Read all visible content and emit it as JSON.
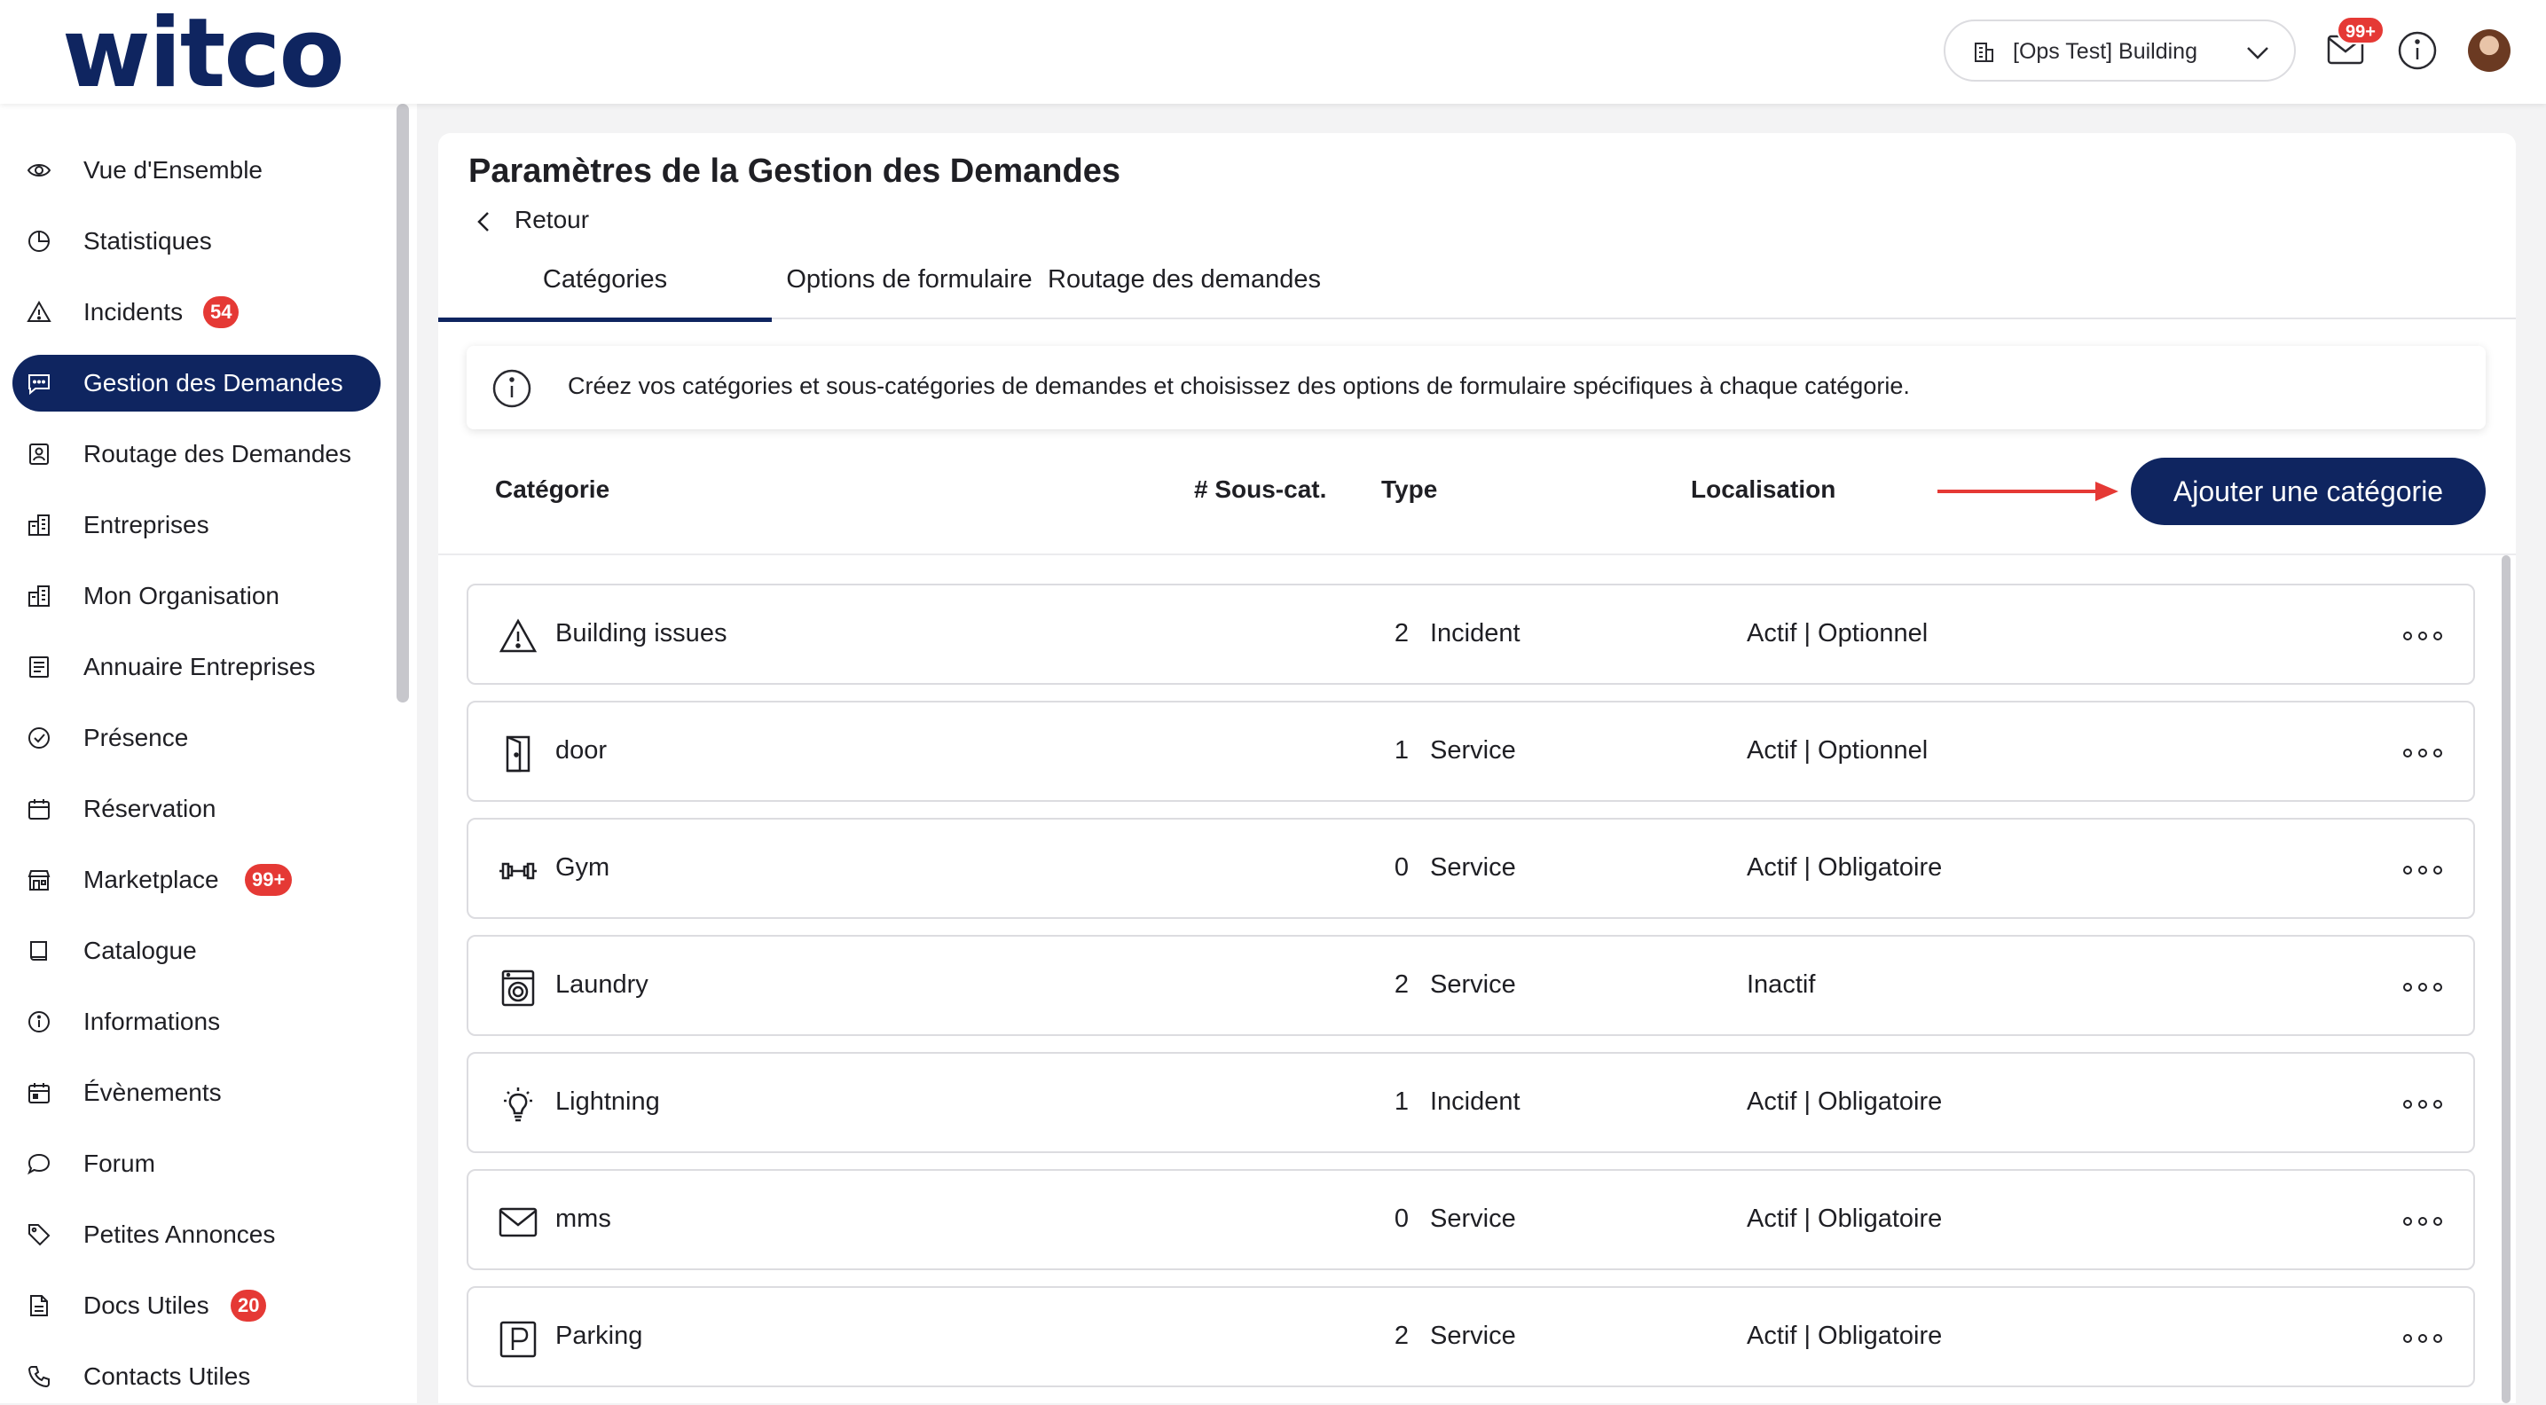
{
  "header": {
    "logo_text": "witco",
    "building_selector": {
      "value": "[Ops Test] Building"
    },
    "mail_badge": "99+",
    "colors": {
      "brand": "#0f2560",
      "badge": "#e53935"
    }
  },
  "sidebar": {
    "items": [
      {
        "label": "Vue d'Ensemble",
        "icon": "eye-icon"
      },
      {
        "label": "Statistiques",
        "icon": "pie-chart-icon"
      },
      {
        "label": "Incidents",
        "icon": "warning-icon",
        "badge": "54"
      },
      {
        "label": "Gestion des Demandes",
        "icon": "chat-icon",
        "active": true
      },
      {
        "label": "Routage des Demandes",
        "icon": "contact-card-icon"
      },
      {
        "label": "Entreprises",
        "icon": "buildings-icon"
      },
      {
        "label": "Mon Organisation",
        "icon": "buildings-icon"
      },
      {
        "label": "Annuaire Entreprises",
        "icon": "directory-icon"
      },
      {
        "label": "Présence",
        "icon": "check-circle-icon"
      },
      {
        "label": "Réservation",
        "icon": "calendar-icon"
      },
      {
        "label": "Marketplace",
        "icon": "store-icon",
        "badge": "99+"
      },
      {
        "label": "Catalogue",
        "icon": "book-icon"
      },
      {
        "label": "Informations",
        "icon": "info-icon"
      },
      {
        "label": "Évènements",
        "icon": "calendar-event-icon"
      },
      {
        "label": "Forum",
        "icon": "speech-bubble-icon"
      },
      {
        "label": "Petites Annonces",
        "icon": "tag-icon"
      },
      {
        "label": "Docs Utiles",
        "icon": "document-icon",
        "badge": "20"
      },
      {
        "label": "Contacts Utiles",
        "icon": "phone-icon"
      }
    ]
  },
  "main": {
    "title": "Paramètres de la Gestion des Demandes",
    "back_label": "Retour",
    "tabs": [
      {
        "label": "Catégories",
        "active": true
      },
      {
        "label": "Options de formulaire"
      },
      {
        "label": "Routage des demandes"
      }
    ],
    "info_text": "Créez vos catégories et sous-catégories de demandes et choisissez des options de formulaire spécifiques à chaque catégorie.",
    "columns": {
      "category": "Catégorie",
      "subcats": "# Sous-cat.",
      "type": "Type",
      "location": "Localisation"
    },
    "add_button": "Ajouter une catégorie",
    "rows": [
      {
        "name": "Building issues",
        "icon": "warning-icon",
        "subcats": "2",
        "type": "Incident",
        "location": "Actif | Optionnel"
      },
      {
        "name": "door",
        "icon": "door-icon",
        "subcats": "1",
        "type": "Service",
        "location": "Actif | Optionnel"
      },
      {
        "name": "Gym",
        "icon": "dumbbell-icon",
        "subcats": "0",
        "type": "Service",
        "location": "Actif | Obligatoire"
      },
      {
        "name": "Laundry",
        "icon": "washing-machine-icon",
        "subcats": "2",
        "type": "Service",
        "location": "Inactif"
      },
      {
        "name": "Lightning",
        "icon": "lightbulb-icon",
        "subcats": "1",
        "type": "Incident",
        "location": "Actif | Obligatoire"
      },
      {
        "name": "mms",
        "icon": "envelope-icon",
        "subcats": "0",
        "type": "Service",
        "location": "Actif | Obligatoire"
      },
      {
        "name": "Parking",
        "icon": "parking-icon",
        "subcats": "2",
        "type": "Service",
        "location": "Actif | Obligatoire"
      }
    ]
  }
}
